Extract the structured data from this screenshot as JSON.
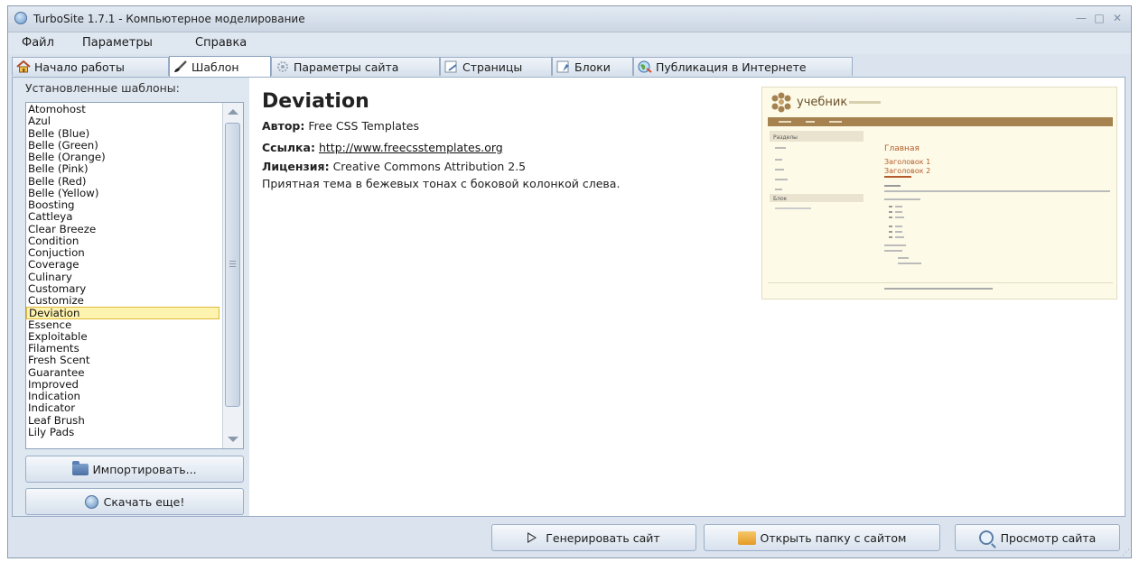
{
  "window": {
    "title": "TurboSite 1.7.1 - Компьютерное моделирование",
    "controls": [
      "—",
      "□",
      "✕"
    ]
  },
  "menu": [
    "Файл",
    "Параметры",
    "Справка"
  ],
  "tabs": [
    {
      "label": "Начало работы",
      "icon": "home-icon",
      "active": false
    },
    {
      "label": "Шаблон",
      "icon": "brush-icon",
      "active": true
    },
    {
      "label": "Параметры сайта",
      "icon": "gear-icon",
      "active": false
    },
    {
      "label": "Страницы",
      "icon": "pages-icon",
      "active": false
    },
    {
      "label": "Блоки",
      "icon": "blocks-icon",
      "active": false
    },
    {
      "label": "Публикация в Интернете",
      "icon": "globe-icon",
      "active": false
    }
  ],
  "templates": {
    "label": "Установленные шаблоны:",
    "items": [
      "Atomohost",
      "Azul",
      "Belle (Blue)",
      "Belle (Green)",
      "Belle (Orange)",
      "Belle (Pink)",
      "Belle (Red)",
      "Belle (Yellow)",
      "Boosting",
      "Cattleya",
      "Clear Breeze",
      "Condition",
      "Conjuction",
      "Coverage",
      "Culinary",
      "Customary",
      "Customize",
      "Deviation",
      "Essence",
      "Exploitable",
      "Filaments",
      "Fresh Scent",
      "Guarantee",
      "Improved",
      "Indication",
      "Indicator",
      "Leaf Brush",
      "Lily Pads"
    ],
    "selected": "Deviation",
    "import_label": "Импортировать...",
    "download_label": "Скачать еще!"
  },
  "details": {
    "title": "Deviation",
    "author_label": "Автор:",
    "author": "Free CSS Templates",
    "link_label": "Ссылка:",
    "link": "http://www.freecsstemplates.org",
    "license_label": "Лицензия:",
    "license": "Creative Commons Attribution 2.5",
    "description": "Приятная тема в бежевых тонах с боковой колонкой слева."
  },
  "preview": {
    "logo": "учебник",
    "sidebar_heading": "Разделы",
    "sidebar_heading2": "Блок",
    "main_heading": "Главная",
    "heading1": "Заголовок 1",
    "heading2": "Заголовок 2"
  },
  "footer": {
    "generate_label": "Генерировать сайт",
    "open_folder_label": "Открыть папку с сайтом",
    "view_site_label": "Просмотр сайта"
  },
  "colors": {
    "accent": "#dbe4ee",
    "selection": "#fff3b0",
    "preview_brown": "#a5824f"
  }
}
